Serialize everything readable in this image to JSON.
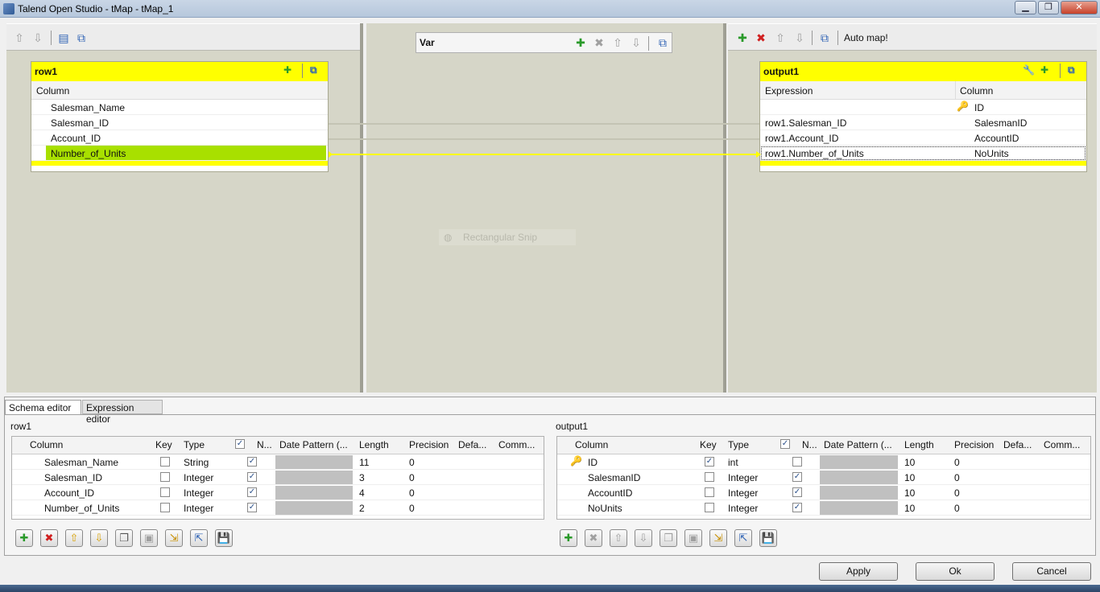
{
  "window": {
    "title": "Talend Open Studio - tMap - tMap_1"
  },
  "icons": {
    "up": "up-arrow-icon",
    "down": "down-arrow-icon",
    "add": "plus-icon",
    "remove": "cross-icon",
    "minimize": "minimize-icon",
    "key": "key-icon"
  },
  "input_table": {
    "name": "row1",
    "column_header": "Column",
    "rows": [
      "Salesman_Name",
      "Salesman_ID",
      "Account_ID",
      "Number_of_Units"
    ]
  },
  "var_table": {
    "name": "Var"
  },
  "output_toolbar": {
    "auto_map": "Auto map!"
  },
  "output_table": {
    "name": "output1",
    "expression_header": "Expression",
    "column_header": "Column",
    "rows": [
      {
        "expression": "",
        "column": "ID"
      },
      {
        "expression": "row1.Salesman_ID",
        "column": "SalesmanID"
      },
      {
        "expression": "row1.Account_ID",
        "column": "AccountID"
      },
      {
        "expression": "row1.Number_of_Units",
        "column": "NoUnits"
      }
    ]
  },
  "snip_overlay": "Rectangular Snip",
  "tabs": [
    "Schema editor",
    "Expression editor"
  ],
  "schema_headers": [
    "Column",
    "Key",
    "Type",
    "N...",
    "Date Pattern (...",
    "Length",
    "Precision",
    "Defa...",
    "Comm..."
  ],
  "schema_left": {
    "label": "row1",
    "rows": [
      {
        "column": "Salesman_Name",
        "type": "String",
        "length": "11",
        "precision": "0"
      },
      {
        "column": "Salesman_ID",
        "type": "Integer",
        "length": "3",
        "precision": "0"
      },
      {
        "column": "Account_ID",
        "type": "Integer",
        "length": "4",
        "precision": "0"
      },
      {
        "column": "Number_of_Units",
        "type": "Integer",
        "length": "2",
        "precision": "0"
      }
    ]
  },
  "schema_right": {
    "label": "output1",
    "rows": [
      {
        "column": "ID",
        "type": "int",
        "length": "10",
        "precision": "0"
      },
      {
        "column": "SalesmanID",
        "type": "Integer",
        "length": "10",
        "precision": "0"
      },
      {
        "column": "AccountID",
        "type": "Integer",
        "length": "10",
        "precision": "0"
      },
      {
        "column": "NoUnits",
        "type": "Integer",
        "length": "10",
        "precision": "0"
      }
    ]
  },
  "buttons": {
    "apply": "Apply",
    "ok": "Ok",
    "cancel": "Cancel"
  }
}
